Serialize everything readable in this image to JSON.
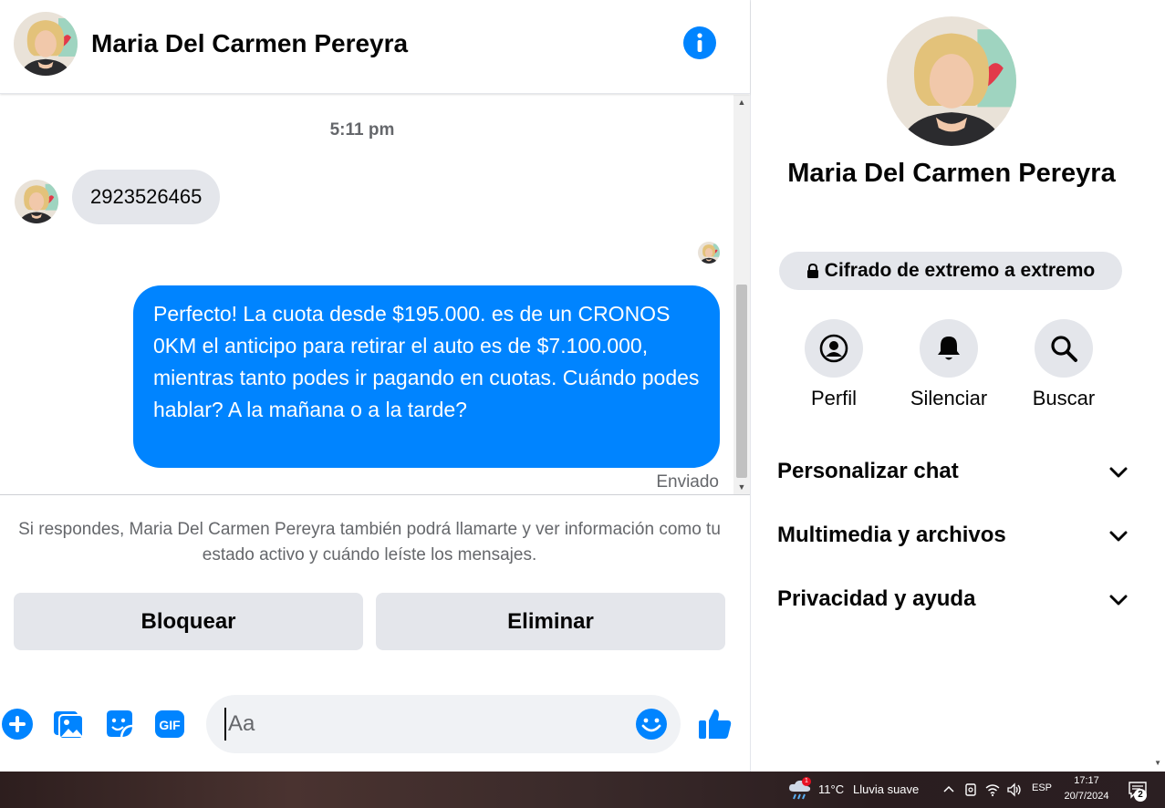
{
  "header": {
    "contact_name": "Maria Del Carmen Pereyra"
  },
  "conversation": {
    "timestamp": "5:11 pm",
    "incoming_message": "2923526465",
    "outgoing_message": "Perfecto! La cuota desde $195.000. es de un CRONOS 0KM el anticipo para retirar el auto es de $7.100.000, mientras tanto podes ir pagando en cuotas. Cuándo podes hablar? A la mañana o a la tarde?",
    "sent_status": "Enviado"
  },
  "request_notice": "Si respondes, Maria Del Carmen Pereyra también podrá llamarte y ver información como tu estado activo y cuándo leíste los mensajes.",
  "actions": {
    "block_label": "Bloquear",
    "delete_label": "Eliminar"
  },
  "composer": {
    "placeholder": "Aa",
    "icons": [
      "plus-icon",
      "photo-icon",
      "sticker-icon",
      "gif-icon",
      "emoji-icon",
      "like-icon"
    ]
  },
  "panel": {
    "contact_name": "Maria Del Carmen Pereyra",
    "encryption_label": "Cifrado de extremo a extremo",
    "quick_actions": [
      {
        "label": "Perfil",
        "icon": "profile-icon"
      },
      {
        "label": "Silenciar",
        "icon": "bell-icon"
      },
      {
        "label": "Buscar",
        "icon": "search-icon"
      }
    ],
    "sections": [
      {
        "label": "Personalizar chat"
      },
      {
        "label": "Multimedia y archivos"
      },
      {
        "label": "Privacidad y ayuda"
      }
    ]
  },
  "taskbar": {
    "weather_temp": "11°C",
    "weather_desc": "Lluvia suave",
    "weather_badge": "1",
    "language": "ESP",
    "time": "17:17",
    "date": "20/7/2024",
    "notification_count": "2"
  },
  "colors": {
    "accent": "#0084ff",
    "bubble_in": "#e4e6eb",
    "secondary_text": "#65676b"
  }
}
